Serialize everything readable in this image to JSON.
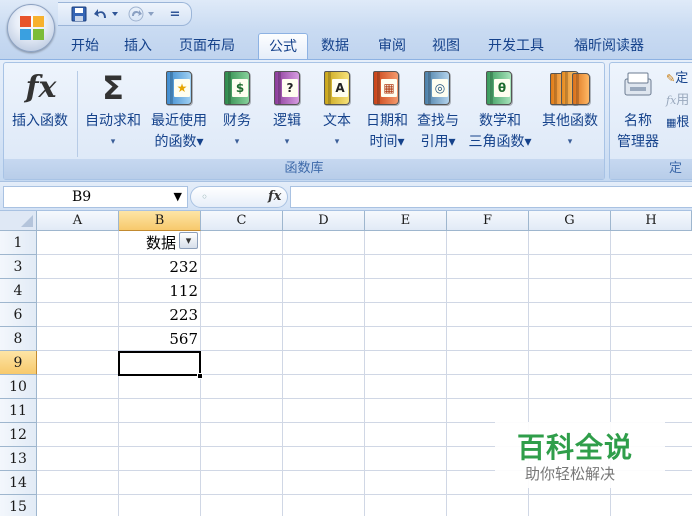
{
  "quick_access": {
    "save_icon": "save-icon",
    "undo_icon": "undo-icon",
    "redo_icon": "redo-icon",
    "customize_glyph": "="
  },
  "tabs": [
    {
      "label": "开始",
      "active": false
    },
    {
      "label": "插入",
      "active": false
    },
    {
      "label": "页面布局",
      "active": false
    },
    {
      "label": "公式",
      "active": true
    },
    {
      "label": "数据",
      "active": false
    },
    {
      "label": "审阅",
      "active": false
    },
    {
      "label": "视图",
      "active": false
    },
    {
      "label": "开发工具",
      "active": false
    },
    {
      "label": "福昕阅读器",
      "active": false
    }
  ],
  "ribbon": {
    "function_library": {
      "group_label": "函数库",
      "insert_function": {
        "label": "插入函数",
        "glyph": "fx"
      },
      "autosum": {
        "label1": "自动求和",
        "label2": "▾",
        "glyph": "Σ"
      },
      "recently_used": {
        "label1": "最近使用",
        "label2": "的函数▾",
        "glyph": "★"
      },
      "financial": {
        "label1": "财务",
        "label2": "▾",
        "glyph": "$"
      },
      "logical": {
        "label1": "逻辑",
        "label2": "▾",
        "glyph": "?"
      },
      "text": {
        "label1": "文本",
        "label2": "▾",
        "glyph": "A"
      },
      "date_time": {
        "label1": "日期和",
        "label2": "时间▾",
        "glyph": "▦"
      },
      "lookup_reference": {
        "label1": "查找与",
        "label2": "引用▾",
        "glyph": "◎"
      },
      "math_trig": {
        "label1": "数学和",
        "label2": "三角函数▾",
        "glyph": "θ"
      },
      "more_functions": {
        "label1": "其他函数",
        "label2": "▾",
        "glyph": ""
      }
    },
    "defined_names": {
      "group_label": "定",
      "name_manager": {
        "label1": "名称",
        "label2": "管理器"
      },
      "small_1": "定",
      "small_2": "用",
      "small_3": "根"
    }
  },
  "formula_bar": {
    "name_box": "B9",
    "name_box_arrow": "▼",
    "fx_label": "fx",
    "formula": ""
  },
  "grid": {
    "columns": [
      "A",
      "B",
      "C",
      "D",
      "E",
      "F",
      "G",
      "H"
    ],
    "rows": [
      "1",
      "3",
      "4",
      "6",
      "8",
      "9",
      "10",
      "11",
      "12",
      "13",
      "14",
      "15"
    ],
    "selected_column": "B",
    "selected_row": "9",
    "header_cell": "数据",
    "filter_glyph": "▾",
    "values": [
      "232",
      "112",
      "223",
      "567"
    ]
  },
  "watermark": {
    "title": "百科全说",
    "subtitle": "助你轻松解决"
  },
  "colors": {
    "ribbon_text": "#15428b",
    "selected_header": "#f7c96c",
    "watermark_green": "#2f9e4a"
  }
}
